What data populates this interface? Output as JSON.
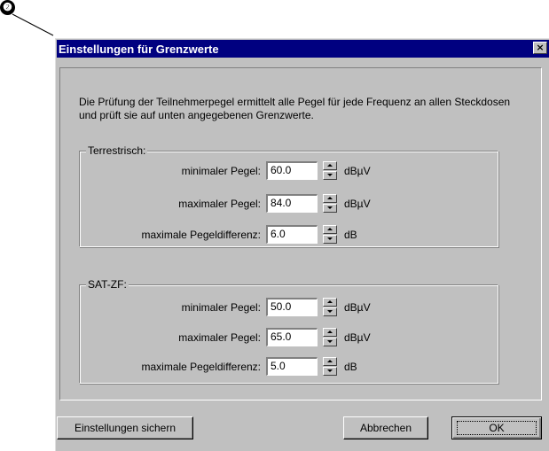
{
  "callout": {
    "number": "❷"
  },
  "window": {
    "title": "Einstellungen für Grenzwerte",
    "close_label": "×"
  },
  "description": "Die Prüfung der Teilnehmerpegel ermittelt alle Pegel für jede Frequenz an allen Steckdosen und prüft sie auf unten angegebenen Grenzwerte.",
  "groups": {
    "terrestrisch": {
      "title": "Terrestrisch:",
      "fields": [
        {
          "label": "minimaler Pegel:",
          "value": "60.0",
          "unit": "dBµV"
        },
        {
          "label": "maximaler Pegel:",
          "value": "84.0",
          "unit": "dBµV"
        },
        {
          "label": "maximale Pegeldifferenz:",
          "value": "6.0",
          "unit": "dB"
        }
      ]
    },
    "sat_zf": {
      "title": "SAT-ZF:",
      "fields": [
        {
          "label": "minimaler Pegel:",
          "value": "50.0",
          "unit": "dBµV"
        },
        {
          "label": "maximaler Pegel:",
          "value": "65.0",
          "unit": "dBµV"
        },
        {
          "label": "maximale Pegeldifferenz:",
          "value": "5.0",
          "unit": "dB"
        }
      ]
    }
  },
  "buttons": {
    "save": "Einstellungen sichern",
    "cancel": "Abbrechen",
    "ok": "OK"
  },
  "colors": {
    "titlebar": "#000080",
    "dialog_face": "#c0c0c0"
  }
}
